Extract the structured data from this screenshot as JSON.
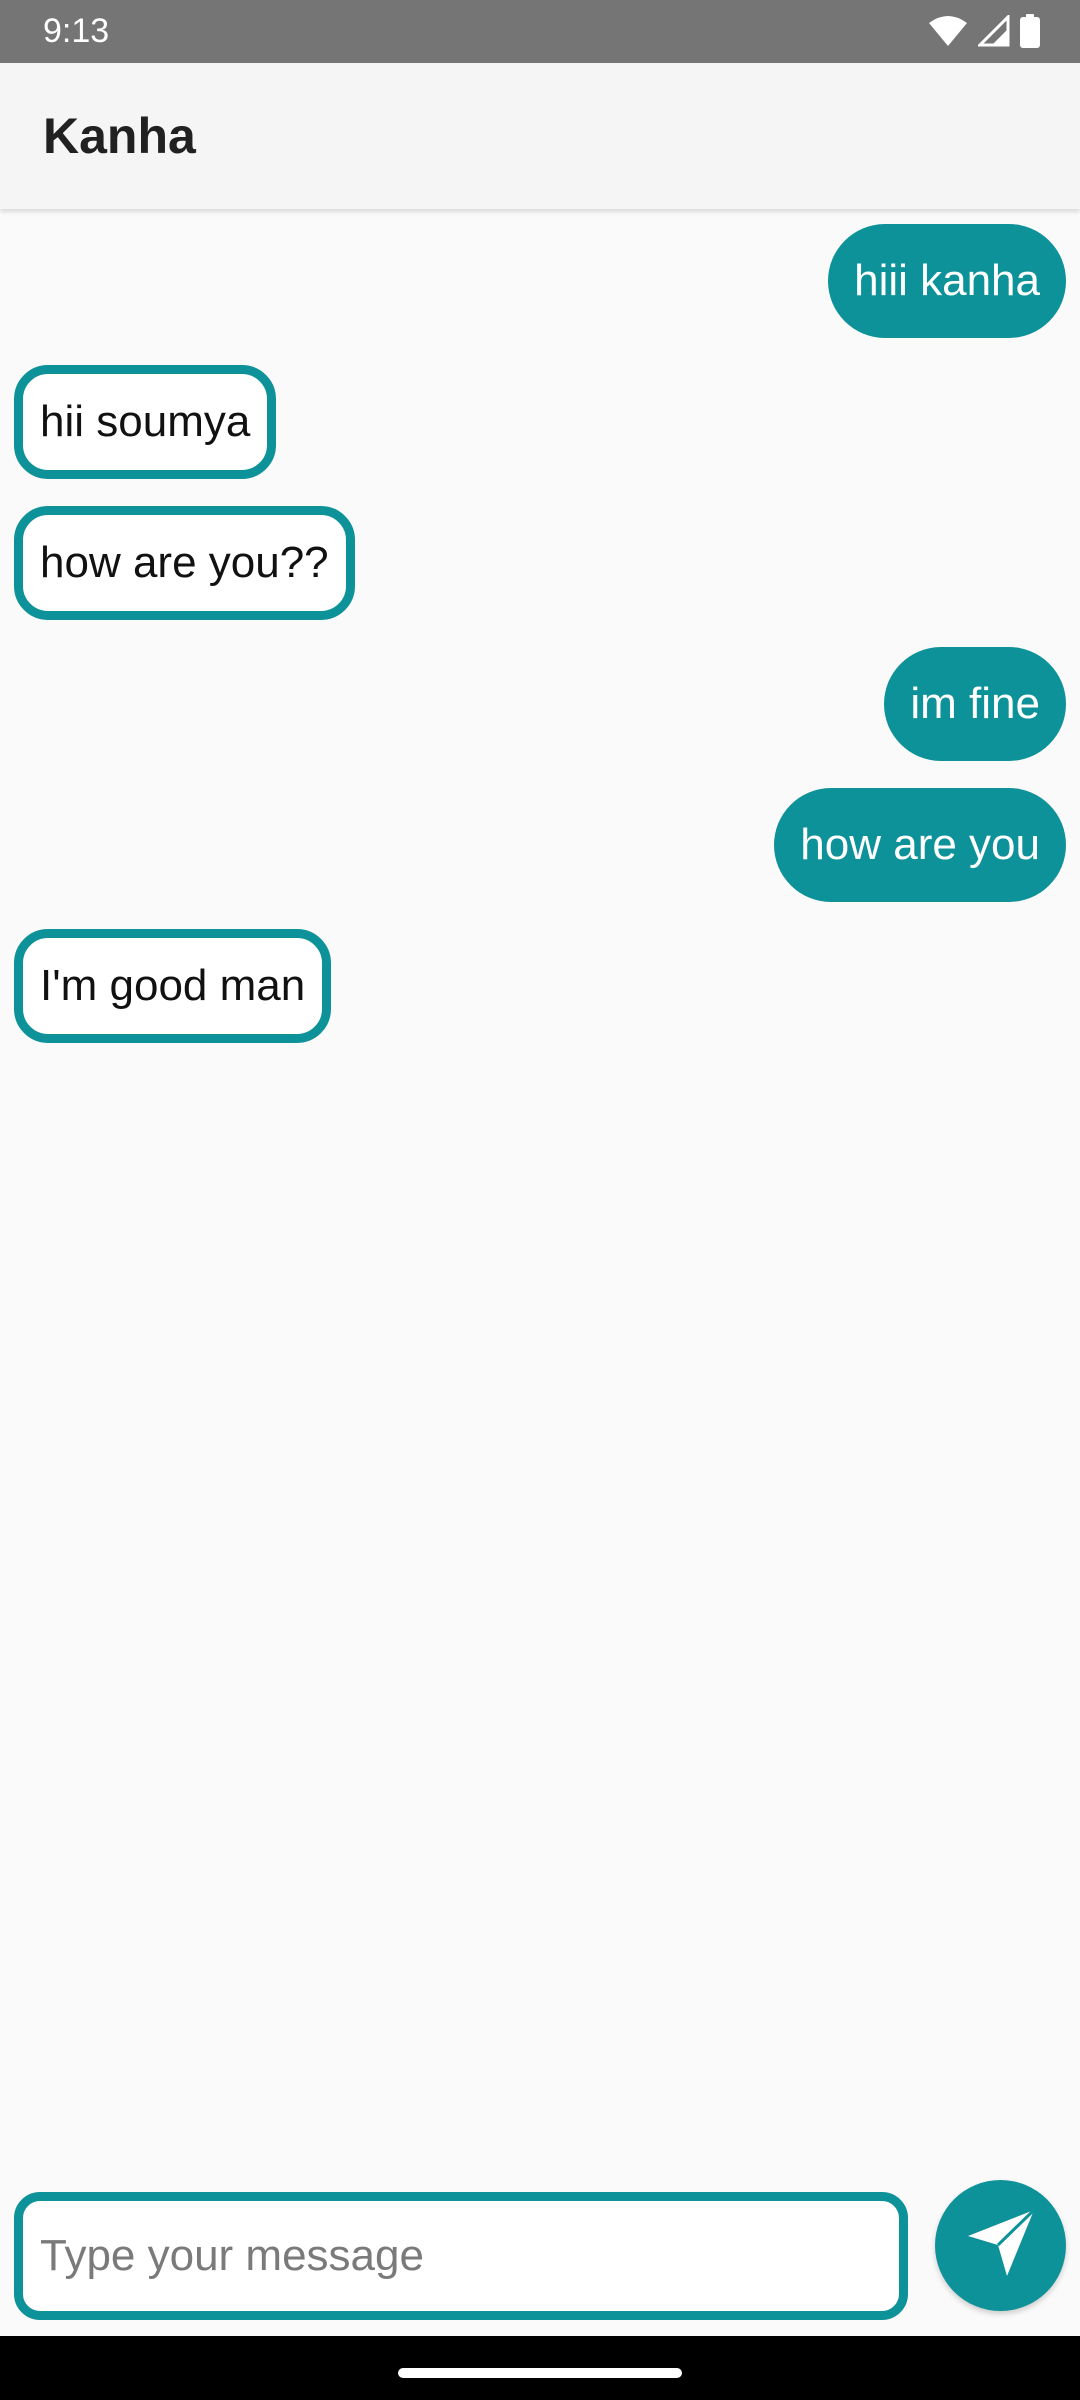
{
  "status_bar": {
    "time": "9:13",
    "icons": [
      "wifi-icon",
      "cellular-signal-icon",
      "battery-icon"
    ]
  },
  "app_bar": {
    "title": "Kanha"
  },
  "messages": [
    {
      "direction": "sent",
      "text": "hiii kanha"
    },
    {
      "direction": "received",
      "text": "hii soumya"
    },
    {
      "direction": "received",
      "text": "how are you??"
    },
    {
      "direction": "sent",
      "text": "im fine"
    },
    {
      "direction": "sent",
      "text": "how are you"
    },
    {
      "direction": "received",
      "text": "I'm good man"
    }
  ],
  "composer": {
    "placeholder": "Type your message",
    "value": "",
    "send_icon": "send-icon"
  },
  "colors": {
    "accent": "#0e9299",
    "status_bar": "#757575",
    "app_bar": "#f5f5f5",
    "background": "#fafafa",
    "sent_text": "#ffffff",
    "received_bg": "#ffffff"
  }
}
